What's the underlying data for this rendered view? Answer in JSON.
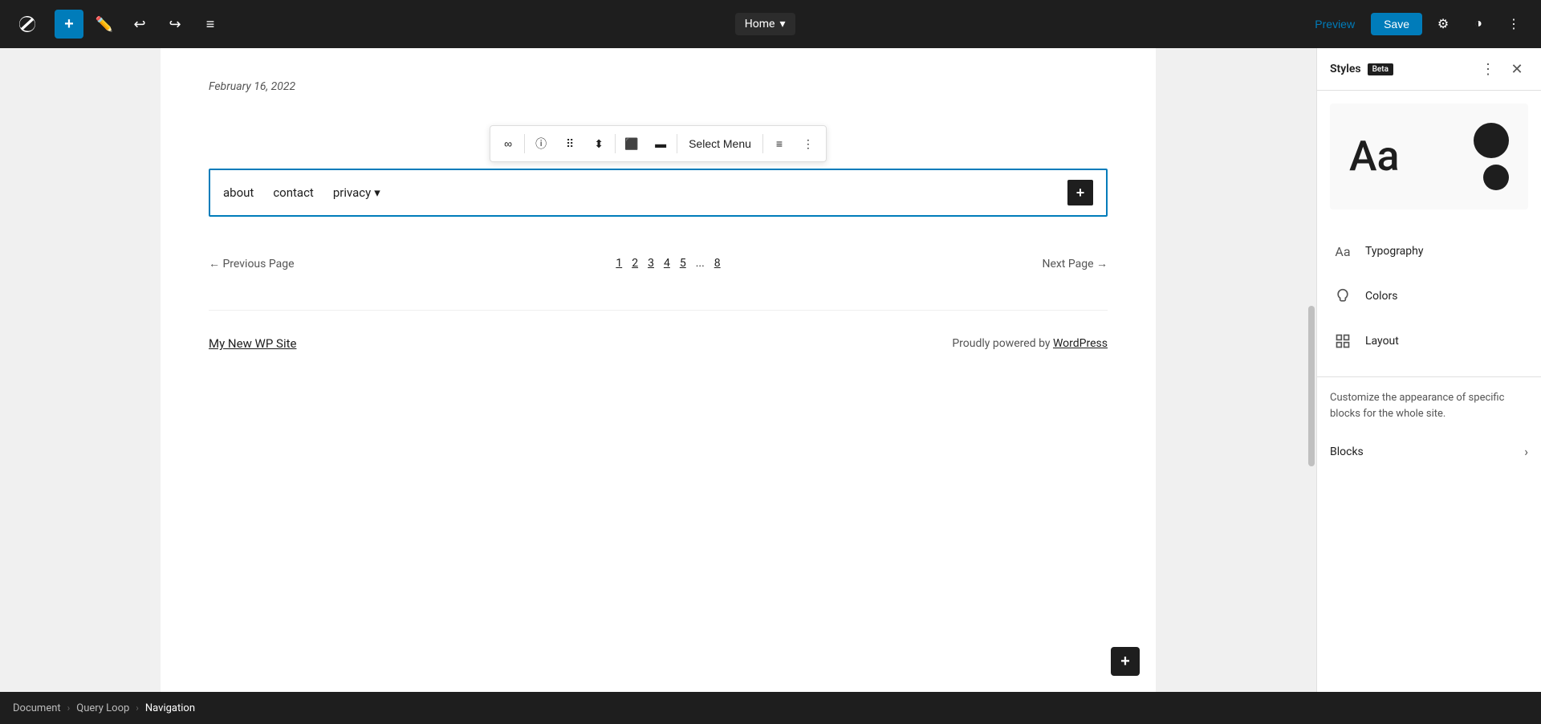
{
  "toolbar": {
    "add_label": "+",
    "page_title": "Home",
    "preview_label": "Preview",
    "save_label": "Save",
    "undo_icon": "↩",
    "redo_icon": "↪",
    "list_view_icon": "≡"
  },
  "canvas": {
    "date": "February 16, 2022",
    "nav": {
      "items": [
        "about",
        "contact",
        "privacy"
      ],
      "privacy_has_dropdown": true
    },
    "pagination": {
      "prev_label": "← Previous Page",
      "next_label": "Next Page →",
      "pages": [
        "1",
        "2",
        "3",
        "4",
        "5",
        "...",
        "8"
      ]
    },
    "footer": {
      "site_name": "My New WP Site",
      "powered_text": "Proudly powered by ",
      "powered_link": "WordPress"
    }
  },
  "styles_panel": {
    "title": "Styles",
    "beta_label": "Beta",
    "preview_text": "Aa",
    "typography_label": "Typography",
    "colors_label": "Colors",
    "layout_label": "Layout",
    "description": "Customize the appearance of specific blocks for the whole site.",
    "blocks_label": "Blocks"
  },
  "breadcrumb": {
    "items": [
      "Document",
      "Query Loop",
      "Navigation"
    ]
  }
}
